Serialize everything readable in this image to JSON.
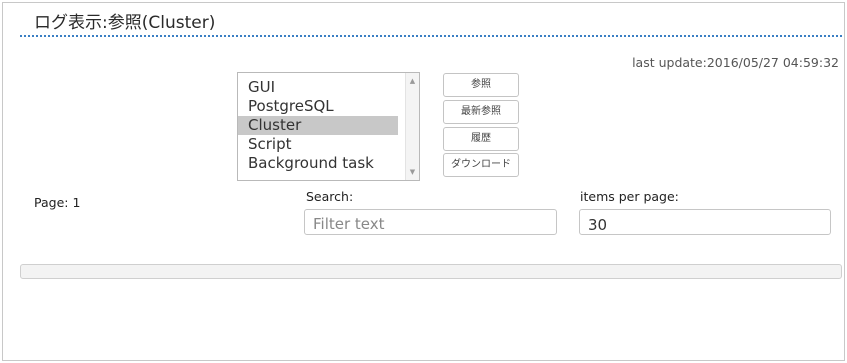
{
  "page": {
    "title": "ログ表示:参照(Cluster)",
    "last_update": "last update:2016/05/27 04:59:32"
  },
  "log_list": {
    "items": [
      "GUI",
      "PostgreSQL",
      "Cluster",
      "Script",
      "Background task"
    ],
    "selected": "Cluster"
  },
  "buttons": {
    "view": "参照",
    "latest_view": "最新参照",
    "history": "履歴",
    "download": "ダウンロード"
  },
  "pagination": {
    "page_label": "Page: 1"
  },
  "search": {
    "label": "Search:",
    "placeholder": "Filter text",
    "value": ""
  },
  "items_per_page": {
    "label": "items per page:",
    "value": "30"
  },
  "progress": {
    "fraction": 0
  }
}
